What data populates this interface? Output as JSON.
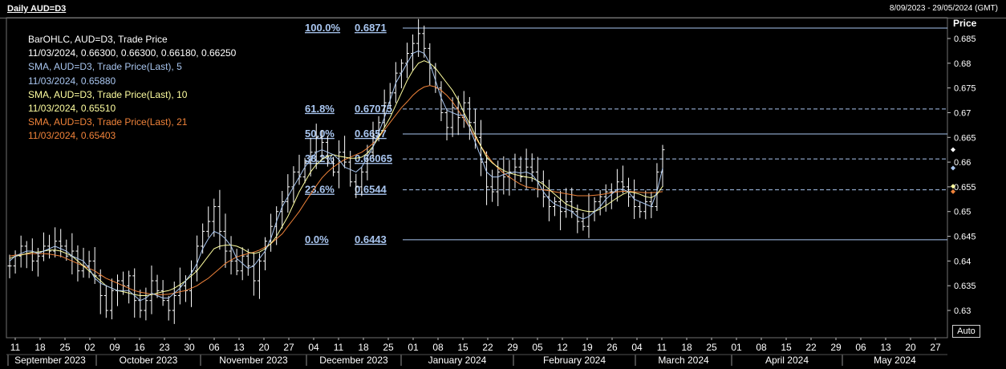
{
  "header": {
    "title": "Daily AUD=D3",
    "date_range": "8/09/2023 - 29/05/2024 (GMT)"
  },
  "axis": {
    "y_label": "Price",
    "auto_label": "Auto"
  },
  "legend": [
    {
      "text": "BarOHLC, AUD=D3, Trade Price",
      "color": "#ffffff"
    },
    {
      "text": "11/03/2024, 0.66300, 0.66300, 0.66180, 0.66250",
      "color": "#ffffff"
    },
    {
      "text": "SMA, AUD=D3, Trade Price(Last),   5",
      "color": "#a9c6f0"
    },
    {
      "text": "11/03/2024, 0.65880",
      "color": "#a9c6f0"
    },
    {
      "text": "SMA, AUD=D3, Trade Price(Last),   10",
      "color": "#ffffa0"
    },
    {
      "text": "11/03/2024, 0.65510",
      "color": "#ffffa0"
    },
    {
      "text": "SMA, AUD=D3, Trade Price(Last),   21",
      "color": "#f0833a"
    },
    {
      "text": "11/03/2024, 0.65403",
      "color": "#f0833a"
    }
  ],
  "colors": {
    "background": "#000000",
    "bars": "#ffffff",
    "sma5": "#a9c6f0",
    "sma10": "#ffffa0",
    "sma21": "#f0833a",
    "fib": "#a9c6f0"
  },
  "chart_data": {
    "type": "bar",
    "title": "Daily AUD=D3",
    "ylabel": "Price",
    "ylim": [
      0.624,
      0.688
    ],
    "y_ticks": [
      "0.685",
      "0.68",
      "0.675",
      "0.67",
      "0.665",
      "0.66",
      "0.655",
      "0.65",
      "0.645",
      "0.64",
      "0.635",
      "0.63"
    ],
    "x_day_labels": [
      "11",
      "18",
      "25",
      "02",
      "09",
      "16",
      "23",
      "30",
      "06",
      "13",
      "20",
      "27",
      "04",
      "11",
      "18",
      "25",
      "01",
      "08",
      "15",
      "22",
      "29",
      "05",
      "12",
      "19",
      "26",
      "04",
      "11",
      "18",
      "25",
      "01",
      "08",
      "15",
      "22",
      "29",
      "06",
      "13",
      "20",
      "27"
    ],
    "x_month_labels": [
      "September 2023",
      "October 2023",
      "November 2023",
      "December 2023",
      "January 2024",
      "February 2024",
      "March 2024",
      "April 2024",
      "May 2024"
    ],
    "fibonacci": [
      {
        "pct": "100.0%",
        "value": "0.6871",
        "level": 0.6871
      },
      {
        "pct": "61.8%",
        "value": "0.67075",
        "level": 0.67075
      },
      {
        "pct": "50.0%",
        "value": "0.6657",
        "level": 0.6657
      },
      {
        "pct": "38.2%",
        "value": "0.66065",
        "level": 0.66065
      },
      {
        "pct": "23.6%",
        "value": "0.6544",
        "level": 0.6544
      },
      {
        "pct": "0.0%",
        "value": "0.6443",
        "level": 0.6443
      }
    ],
    "last_values": {
      "close": 0.6625,
      "sma5": 0.6588,
      "sma10": 0.6551,
      "sma21": 0.65403
    },
    "close_series": [
      0.639,
      0.641,
      0.643,
      0.642,
      0.64,
      0.641,
      0.643,
      0.642,
      0.644,
      0.643,
      0.641,
      0.642,
      0.638,
      0.639,
      0.64,
      0.637,
      0.633,
      0.63,
      0.634,
      0.636,
      0.635,
      0.637,
      0.632,
      0.63,
      0.632,
      0.636,
      0.634,
      0.632,
      0.63,
      0.633,
      0.635,
      0.634,
      0.638,
      0.643,
      0.646,
      0.648,
      0.651,
      0.646,
      0.642,
      0.64,
      0.638,
      0.641,
      0.639,
      0.636,
      0.64,
      0.644,
      0.647,
      0.65,
      0.652,
      0.655,
      0.658,
      0.657,
      0.66,
      0.662,
      0.665,
      0.664,
      0.66,
      0.658,
      0.662,
      0.66,
      0.656,
      0.655,
      0.658,
      0.662,
      0.665,
      0.668,
      0.672,
      0.674,
      0.678,
      0.68,
      0.682,
      0.684,
      0.686,
      0.683,
      0.679,
      0.675,
      0.67,
      0.667,
      0.671,
      0.669,
      0.672,
      0.668,
      0.665,
      0.66,
      0.655,
      0.654,
      0.658,
      0.657,
      0.658,
      0.659,
      0.657,
      0.659,
      0.658,
      0.656,
      0.653,
      0.651,
      0.652,
      0.65,
      0.652,
      0.65,
      0.648,
      0.647,
      0.65,
      0.652,
      0.653,
      0.654,
      0.654,
      0.656,
      0.655,
      0.653,
      0.651,
      0.65,
      0.652,
      0.651,
      0.658,
      0.6625
    ],
    "sma5_series": [
      0.64,
      0.641,
      0.6415,
      0.642,
      0.642,
      0.6415,
      0.642,
      0.6425,
      0.643,
      0.6425,
      0.642,
      0.641,
      0.6405,
      0.64,
      0.6385,
      0.6365,
      0.6355,
      0.635,
      0.6345,
      0.634,
      0.634,
      0.634,
      0.633,
      0.632,
      0.6325,
      0.6335,
      0.633,
      0.6325,
      0.6325,
      0.6335,
      0.6345,
      0.636,
      0.6375,
      0.6395,
      0.6425,
      0.6445,
      0.646,
      0.6455,
      0.6445,
      0.643,
      0.6405,
      0.6395,
      0.6385,
      0.639,
      0.6405,
      0.642,
      0.6445,
      0.648,
      0.651,
      0.653,
      0.655,
      0.657,
      0.659,
      0.6605,
      0.662,
      0.6625,
      0.662,
      0.6615,
      0.6605,
      0.659,
      0.6585,
      0.658,
      0.659,
      0.661,
      0.663,
      0.666,
      0.669,
      0.6725,
      0.676,
      0.678,
      0.68,
      0.682,
      0.6825,
      0.682,
      0.68,
      0.6765,
      0.673,
      0.6705,
      0.67,
      0.6695,
      0.6695,
      0.667,
      0.664,
      0.661,
      0.658,
      0.657,
      0.657,
      0.6575,
      0.6578,
      0.658,
      0.6578,
      0.658,
      0.6575,
      0.656,
      0.654,
      0.6525,
      0.6515,
      0.651,
      0.6505,
      0.65,
      0.649,
      0.6485,
      0.649,
      0.65,
      0.651,
      0.6525,
      0.6535,
      0.6545,
      0.6545,
      0.654,
      0.6525,
      0.652,
      0.6515,
      0.651,
      0.654,
      0.6588
    ],
    "sma10_series": [
      0.6405,
      0.641,
      0.6412,
      0.6415,
      0.6418,
      0.6418,
      0.642,
      0.6422,
      0.6422,
      0.642,
      0.6415,
      0.641,
      0.64,
      0.639,
      0.638,
      0.637,
      0.636,
      0.635,
      0.6345,
      0.634,
      0.6338,
      0.6335,
      0.6332,
      0.633,
      0.633,
      0.6332,
      0.6335,
      0.6338,
      0.634,
      0.6345,
      0.6352,
      0.636,
      0.637,
      0.638,
      0.6395,
      0.641,
      0.6425,
      0.643,
      0.6432,
      0.6432,
      0.643,
      0.6425,
      0.6418,
      0.6415,
      0.6418,
      0.6425,
      0.6435,
      0.645,
      0.647,
      0.649,
      0.6515,
      0.654,
      0.656,
      0.658,
      0.6595,
      0.6605,
      0.6612,
      0.6615,
      0.6612,
      0.661,
      0.6608,
      0.6608,
      0.661,
      0.6618,
      0.6632,
      0.665,
      0.667,
      0.669,
      0.6715,
      0.674,
      0.6765,
      0.6785,
      0.68,
      0.6805,
      0.68,
      0.679,
      0.6775,
      0.676,
      0.6745,
      0.6725,
      0.67,
      0.6678,
      0.6655,
      0.6632,
      0.661,
      0.6598,
      0.659,
      0.6583,
      0.6578,
      0.6575,
      0.6572,
      0.657,
      0.6568,
      0.6562,
      0.6555,
      0.6545,
      0.6535,
      0.6525,
      0.6515,
      0.651,
      0.6505,
      0.6502,
      0.65,
      0.65,
      0.6505,
      0.6512,
      0.652,
      0.6528,
      0.6535,
      0.654,
      0.6538,
      0.6535,
      0.653,
      0.6528,
      0.6535,
      0.6551
    ],
    "sma21_series": [
      0.641,
      0.6412,
      0.6413,
      0.6414,
      0.6415,
      0.6415,
      0.6415,
      0.6414,
      0.6412,
      0.641,
      0.6405,
      0.64,
      0.6395,
      0.639,
      0.6385,
      0.638,
      0.6372,
      0.6365,
      0.636,
      0.6355,
      0.635,
      0.6345,
      0.634,
      0.6337,
      0.6335,
      0.6333,
      0.6332,
      0.6332,
      0.6333,
      0.6335,
      0.6338,
      0.634,
      0.6345,
      0.635,
      0.6358,
      0.6365,
      0.6375,
      0.6385,
      0.6395,
      0.6402,
      0.6408,
      0.6412,
      0.6415,
      0.6418,
      0.6422,
      0.6428,
      0.6435,
      0.6445,
      0.6455,
      0.647,
      0.6485,
      0.65,
      0.6518,
      0.6535,
      0.6552,
      0.6568,
      0.658,
      0.659,
      0.6598,
      0.6605,
      0.661,
      0.6615,
      0.662,
      0.6628,
      0.6638,
      0.665,
      0.6665,
      0.668,
      0.6695,
      0.671,
      0.6722,
      0.6735,
      0.6745,
      0.6752,
      0.6755,
      0.6752,
      0.6745,
      0.6735,
      0.6722,
      0.6705,
      0.6688,
      0.667,
      0.665,
      0.6632,
      0.6615,
      0.66,
      0.6588,
      0.6578,
      0.657,
      0.6562,
      0.6555,
      0.655,
      0.6548,
      0.6545,
      0.6544,
      0.6542,
      0.654,
      0.6538,
      0.6536,
      0.6534,
      0.6532,
      0.6532,
      0.6532,
      0.6533,
      0.6534,
      0.6536,
      0.6538,
      0.654,
      0.6541,
      0.6541,
      0.654,
      0.6539,
      0.6538,
      0.6538,
      0.6539,
      0.65403
    ]
  }
}
